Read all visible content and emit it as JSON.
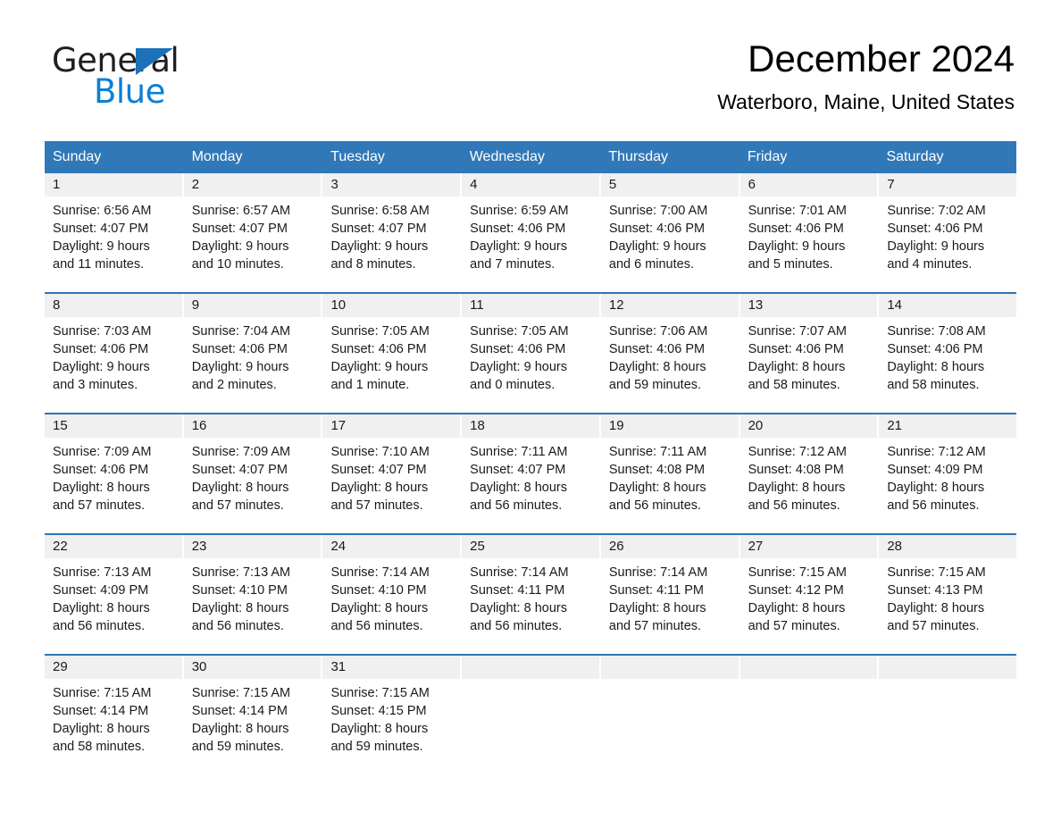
{
  "brand": {
    "name_part1": "General",
    "name_part2": "Blue",
    "triangle_color": "#1b72bb",
    "blue_color": "#0b80d4"
  },
  "header": {
    "title": "December 2024",
    "location": "Waterboro, Maine, United States"
  },
  "theme": {
    "header_blue": "#3178b8",
    "row_divider_blue": "#2e75b6",
    "day_number_band": "#f0f0f0",
    "text_color": "#1a1a1a"
  },
  "weekdays": [
    "Sunday",
    "Monday",
    "Tuesday",
    "Wednesday",
    "Thursday",
    "Friday",
    "Saturday"
  ],
  "weeks": [
    [
      {
        "date": "1",
        "sunrise": "Sunrise: 6:56 AM",
        "sunset": "Sunset: 4:07 PM",
        "daylight_line1": "Daylight: 9 hours",
        "daylight_line2": "and 11 minutes."
      },
      {
        "date": "2",
        "sunrise": "Sunrise: 6:57 AM",
        "sunset": "Sunset: 4:07 PM",
        "daylight_line1": "Daylight: 9 hours",
        "daylight_line2": "and 10 minutes."
      },
      {
        "date": "3",
        "sunrise": "Sunrise: 6:58 AM",
        "sunset": "Sunset: 4:07 PM",
        "daylight_line1": "Daylight: 9 hours",
        "daylight_line2": "and 8 minutes."
      },
      {
        "date": "4",
        "sunrise": "Sunrise: 6:59 AM",
        "sunset": "Sunset: 4:06 PM",
        "daylight_line1": "Daylight: 9 hours",
        "daylight_line2": "and 7 minutes."
      },
      {
        "date": "5",
        "sunrise": "Sunrise: 7:00 AM",
        "sunset": "Sunset: 4:06 PM",
        "daylight_line1": "Daylight: 9 hours",
        "daylight_line2": "and 6 minutes."
      },
      {
        "date": "6",
        "sunrise": "Sunrise: 7:01 AM",
        "sunset": "Sunset: 4:06 PM",
        "daylight_line1": "Daylight: 9 hours",
        "daylight_line2": "and 5 minutes."
      },
      {
        "date": "7",
        "sunrise": "Sunrise: 7:02 AM",
        "sunset": "Sunset: 4:06 PM",
        "daylight_line1": "Daylight: 9 hours",
        "daylight_line2": "and 4 minutes."
      }
    ],
    [
      {
        "date": "8",
        "sunrise": "Sunrise: 7:03 AM",
        "sunset": "Sunset: 4:06 PM",
        "daylight_line1": "Daylight: 9 hours",
        "daylight_line2": "and 3 minutes."
      },
      {
        "date": "9",
        "sunrise": "Sunrise: 7:04 AM",
        "sunset": "Sunset: 4:06 PM",
        "daylight_line1": "Daylight: 9 hours",
        "daylight_line2": "and 2 minutes."
      },
      {
        "date": "10",
        "sunrise": "Sunrise: 7:05 AM",
        "sunset": "Sunset: 4:06 PM",
        "daylight_line1": "Daylight: 9 hours",
        "daylight_line2": "and 1 minute."
      },
      {
        "date": "11",
        "sunrise": "Sunrise: 7:05 AM",
        "sunset": "Sunset: 4:06 PM",
        "daylight_line1": "Daylight: 9 hours",
        "daylight_line2": "and 0 minutes."
      },
      {
        "date": "12",
        "sunrise": "Sunrise: 7:06 AM",
        "sunset": "Sunset: 4:06 PM",
        "daylight_line1": "Daylight: 8 hours",
        "daylight_line2": "and 59 minutes."
      },
      {
        "date": "13",
        "sunrise": "Sunrise: 7:07 AM",
        "sunset": "Sunset: 4:06 PM",
        "daylight_line1": "Daylight: 8 hours",
        "daylight_line2": "and 58 minutes."
      },
      {
        "date": "14",
        "sunrise": "Sunrise: 7:08 AM",
        "sunset": "Sunset: 4:06 PM",
        "daylight_line1": "Daylight: 8 hours",
        "daylight_line2": "and 58 minutes."
      }
    ],
    [
      {
        "date": "15",
        "sunrise": "Sunrise: 7:09 AM",
        "sunset": "Sunset: 4:06 PM",
        "daylight_line1": "Daylight: 8 hours",
        "daylight_line2": "and 57 minutes."
      },
      {
        "date": "16",
        "sunrise": "Sunrise: 7:09 AM",
        "sunset": "Sunset: 4:07 PM",
        "daylight_line1": "Daylight: 8 hours",
        "daylight_line2": "and 57 minutes."
      },
      {
        "date": "17",
        "sunrise": "Sunrise: 7:10 AM",
        "sunset": "Sunset: 4:07 PM",
        "daylight_line1": "Daylight: 8 hours",
        "daylight_line2": "and 57 minutes."
      },
      {
        "date": "18",
        "sunrise": "Sunrise: 7:11 AM",
        "sunset": "Sunset: 4:07 PM",
        "daylight_line1": "Daylight: 8 hours",
        "daylight_line2": "and 56 minutes."
      },
      {
        "date": "19",
        "sunrise": "Sunrise: 7:11 AM",
        "sunset": "Sunset: 4:08 PM",
        "daylight_line1": "Daylight: 8 hours",
        "daylight_line2": "and 56 minutes."
      },
      {
        "date": "20",
        "sunrise": "Sunrise: 7:12 AM",
        "sunset": "Sunset: 4:08 PM",
        "daylight_line1": "Daylight: 8 hours",
        "daylight_line2": "and 56 minutes."
      },
      {
        "date": "21",
        "sunrise": "Sunrise: 7:12 AM",
        "sunset": "Sunset: 4:09 PM",
        "daylight_line1": "Daylight: 8 hours",
        "daylight_line2": "and 56 minutes."
      }
    ],
    [
      {
        "date": "22",
        "sunrise": "Sunrise: 7:13 AM",
        "sunset": "Sunset: 4:09 PM",
        "daylight_line1": "Daylight: 8 hours",
        "daylight_line2": "and 56 minutes."
      },
      {
        "date": "23",
        "sunrise": "Sunrise: 7:13 AM",
        "sunset": "Sunset: 4:10 PM",
        "daylight_line1": "Daylight: 8 hours",
        "daylight_line2": "and 56 minutes."
      },
      {
        "date": "24",
        "sunrise": "Sunrise: 7:14 AM",
        "sunset": "Sunset: 4:10 PM",
        "daylight_line1": "Daylight: 8 hours",
        "daylight_line2": "and 56 minutes."
      },
      {
        "date": "25",
        "sunrise": "Sunrise: 7:14 AM",
        "sunset": "Sunset: 4:11 PM",
        "daylight_line1": "Daylight: 8 hours",
        "daylight_line2": "and 56 minutes."
      },
      {
        "date": "26",
        "sunrise": "Sunrise: 7:14 AM",
        "sunset": "Sunset: 4:11 PM",
        "daylight_line1": "Daylight: 8 hours",
        "daylight_line2": "and 57 minutes."
      },
      {
        "date": "27",
        "sunrise": "Sunrise: 7:15 AM",
        "sunset": "Sunset: 4:12 PM",
        "daylight_line1": "Daylight: 8 hours",
        "daylight_line2": "and 57 minutes."
      },
      {
        "date": "28",
        "sunrise": "Sunrise: 7:15 AM",
        "sunset": "Sunset: 4:13 PM",
        "daylight_line1": "Daylight: 8 hours",
        "daylight_line2": "and 57 minutes."
      }
    ],
    [
      {
        "date": "29",
        "sunrise": "Sunrise: 7:15 AM",
        "sunset": "Sunset: 4:14 PM",
        "daylight_line1": "Daylight: 8 hours",
        "daylight_line2": "and 58 minutes."
      },
      {
        "date": "30",
        "sunrise": "Sunrise: 7:15 AM",
        "sunset": "Sunset: 4:14 PM",
        "daylight_line1": "Daylight: 8 hours",
        "daylight_line2": "and 59 minutes."
      },
      {
        "date": "31",
        "sunrise": "Sunrise: 7:15 AM",
        "sunset": "Sunset: 4:15 PM",
        "daylight_line1": "Daylight: 8 hours",
        "daylight_line2": "and 59 minutes."
      },
      {
        "date": "",
        "sunrise": "",
        "sunset": "",
        "daylight_line1": "",
        "daylight_line2": ""
      },
      {
        "date": "",
        "sunrise": "",
        "sunset": "",
        "daylight_line1": "",
        "daylight_line2": ""
      },
      {
        "date": "",
        "sunrise": "",
        "sunset": "",
        "daylight_line1": "",
        "daylight_line2": ""
      },
      {
        "date": "",
        "sunrise": "",
        "sunset": "",
        "daylight_line1": "",
        "daylight_line2": ""
      }
    ]
  ]
}
